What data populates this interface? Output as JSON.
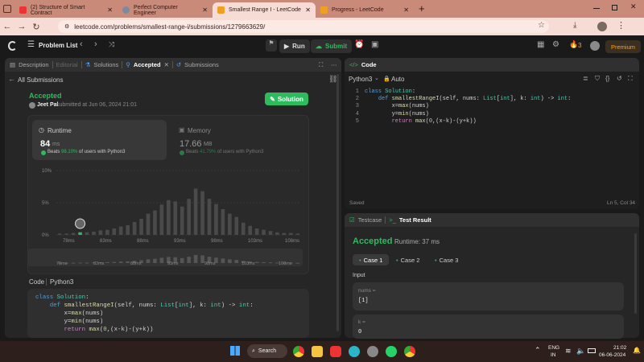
{
  "browser": {
    "tabs": [
      {
        "title": "(2) Structure of Smart Contract",
        "favicon_color": "#e33"
      },
      {
        "title": "Perfect Computer Engineer",
        "favicon_color": "#7a8aa0"
      },
      {
        "title": "Smallest Range I - LeetCode",
        "favicon_color": "#f0a020"
      },
      {
        "title": "Progress - LeetCode",
        "favicon_color": "#f0a020"
      }
    ],
    "new_tab": "+",
    "url": "leetcode.com/problems/smallest-range-i/submissions/1279663629/"
  },
  "lc": {
    "problem_list": "Problem List",
    "run": "Run",
    "submit": "Submit",
    "streak": "3",
    "premium": "Premium"
  },
  "left": {
    "tabs": [
      "Description",
      "Editorial",
      "Solutions",
      "Accepted",
      "Submissions"
    ],
    "all_submissions": "All Submissions",
    "status": "Accepted",
    "user": "Jeet Pal",
    "submitted": "submitted at Jun 06, 2024 21:01",
    "solution_btn": "Solution",
    "runtime_label": "Runtime",
    "runtime_value": "84",
    "runtime_unit": "ms",
    "runtime_beats": "Beats",
    "runtime_pct": "98.10%",
    "runtime_tail": "of users with Python3",
    "memory_label": "Memory",
    "memory_value": "17.66",
    "memory_unit": "MB",
    "memory_beats": "Beats",
    "memory_pct": "41.79%",
    "memory_tail": "of users with Python3",
    "code_label": "Code",
    "code_lang": "Python3"
  },
  "chart_data": {
    "type": "bar",
    "ylabels": [
      "10%",
      "5%",
      "0%"
    ],
    "xlabels": [
      "78ms",
      "83ms",
      "88ms",
      "93ms",
      "98ms",
      "103ms",
      "108ms"
    ],
    "values": [
      0.2,
      0.2,
      0.3,
      0.4,
      0.4,
      0.5,
      0.7,
      0.8,
      1.0,
      1.3,
      1.5,
      2.0,
      2.5,
      3.3,
      3.8,
      4.7,
      5.4,
      5.2,
      4.4,
      5.6,
      7.2,
      6.8,
      5.6,
      4.8,
      4.0,
      3.3,
      2.8,
      1.9,
      1.4,
      1.0,
      0.8,
      0.6,
      0.4,
      0.3,
      0.3,
      0.2
    ],
    "highlight_index": 3,
    "ylim": [
      0,
      10
    ]
  },
  "editor": {
    "title": "Code",
    "lang": "Python3",
    "mode": "Auto",
    "saved": "Saved",
    "cursor": "Ln 5, Col 34",
    "line_numbers": [
      "1",
      "2",
      "3",
      "4",
      "5"
    ]
  },
  "result": {
    "testcase_tab": "Testcase",
    "result_tab": "Test Result",
    "status": "Accepted",
    "runtime": "Runtime: 37 ms",
    "cases": [
      "Case 1",
      "Case 2",
      "Case 3"
    ],
    "input_label": "Input",
    "nums_label": "nums =",
    "nums_value": "[1]",
    "k_label": "k =",
    "k_value": "0"
  },
  "taskbar": {
    "search": "Search",
    "lang": "ENG",
    "region": "IN",
    "time": "21:02",
    "date": "06-06-2024"
  }
}
